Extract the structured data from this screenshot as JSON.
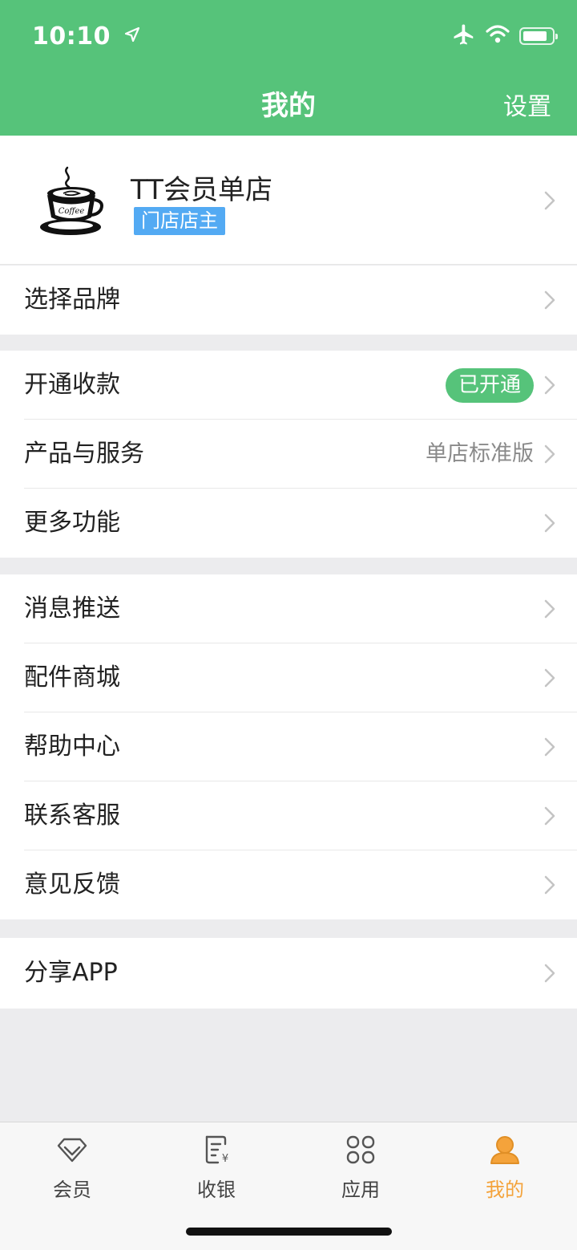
{
  "status_bar": {
    "time": "10:10",
    "battery_level": 0.85
  },
  "header": {
    "title": "我的",
    "settings_label": "设置"
  },
  "profile": {
    "shop_name": "TT会员单店",
    "role": "门店店主",
    "logo_text": "Coffee"
  },
  "groups": [
    {
      "rows": [
        {
          "label": "选择品牌"
        }
      ]
    },
    {
      "rows": [
        {
          "label": "开通收款",
          "pill": "已开通"
        },
        {
          "label": "产品与服务",
          "value": "单店标准版"
        },
        {
          "label": "更多功能"
        }
      ]
    },
    {
      "rows": [
        {
          "label": "消息推送"
        },
        {
          "label": "配件商城"
        },
        {
          "label": "帮助中心"
        },
        {
          "label": "联系客服"
        },
        {
          "label": "意见反馈"
        }
      ]
    },
    {
      "rows": [
        {
          "label": "分享APP"
        }
      ]
    }
  ],
  "tabbar": {
    "tabs": [
      {
        "label": "会员",
        "icon": "diamond-icon"
      },
      {
        "label": "收银",
        "icon": "receipt-icon"
      },
      {
        "label": "应用",
        "icon": "apps-icon"
      },
      {
        "label": "我的",
        "icon": "person-icon"
      }
    ],
    "active_index": 3,
    "active_color": "#f4a33b"
  },
  "colors": {
    "brand_green": "#56c37a",
    "badge_blue": "#53aaf3"
  }
}
